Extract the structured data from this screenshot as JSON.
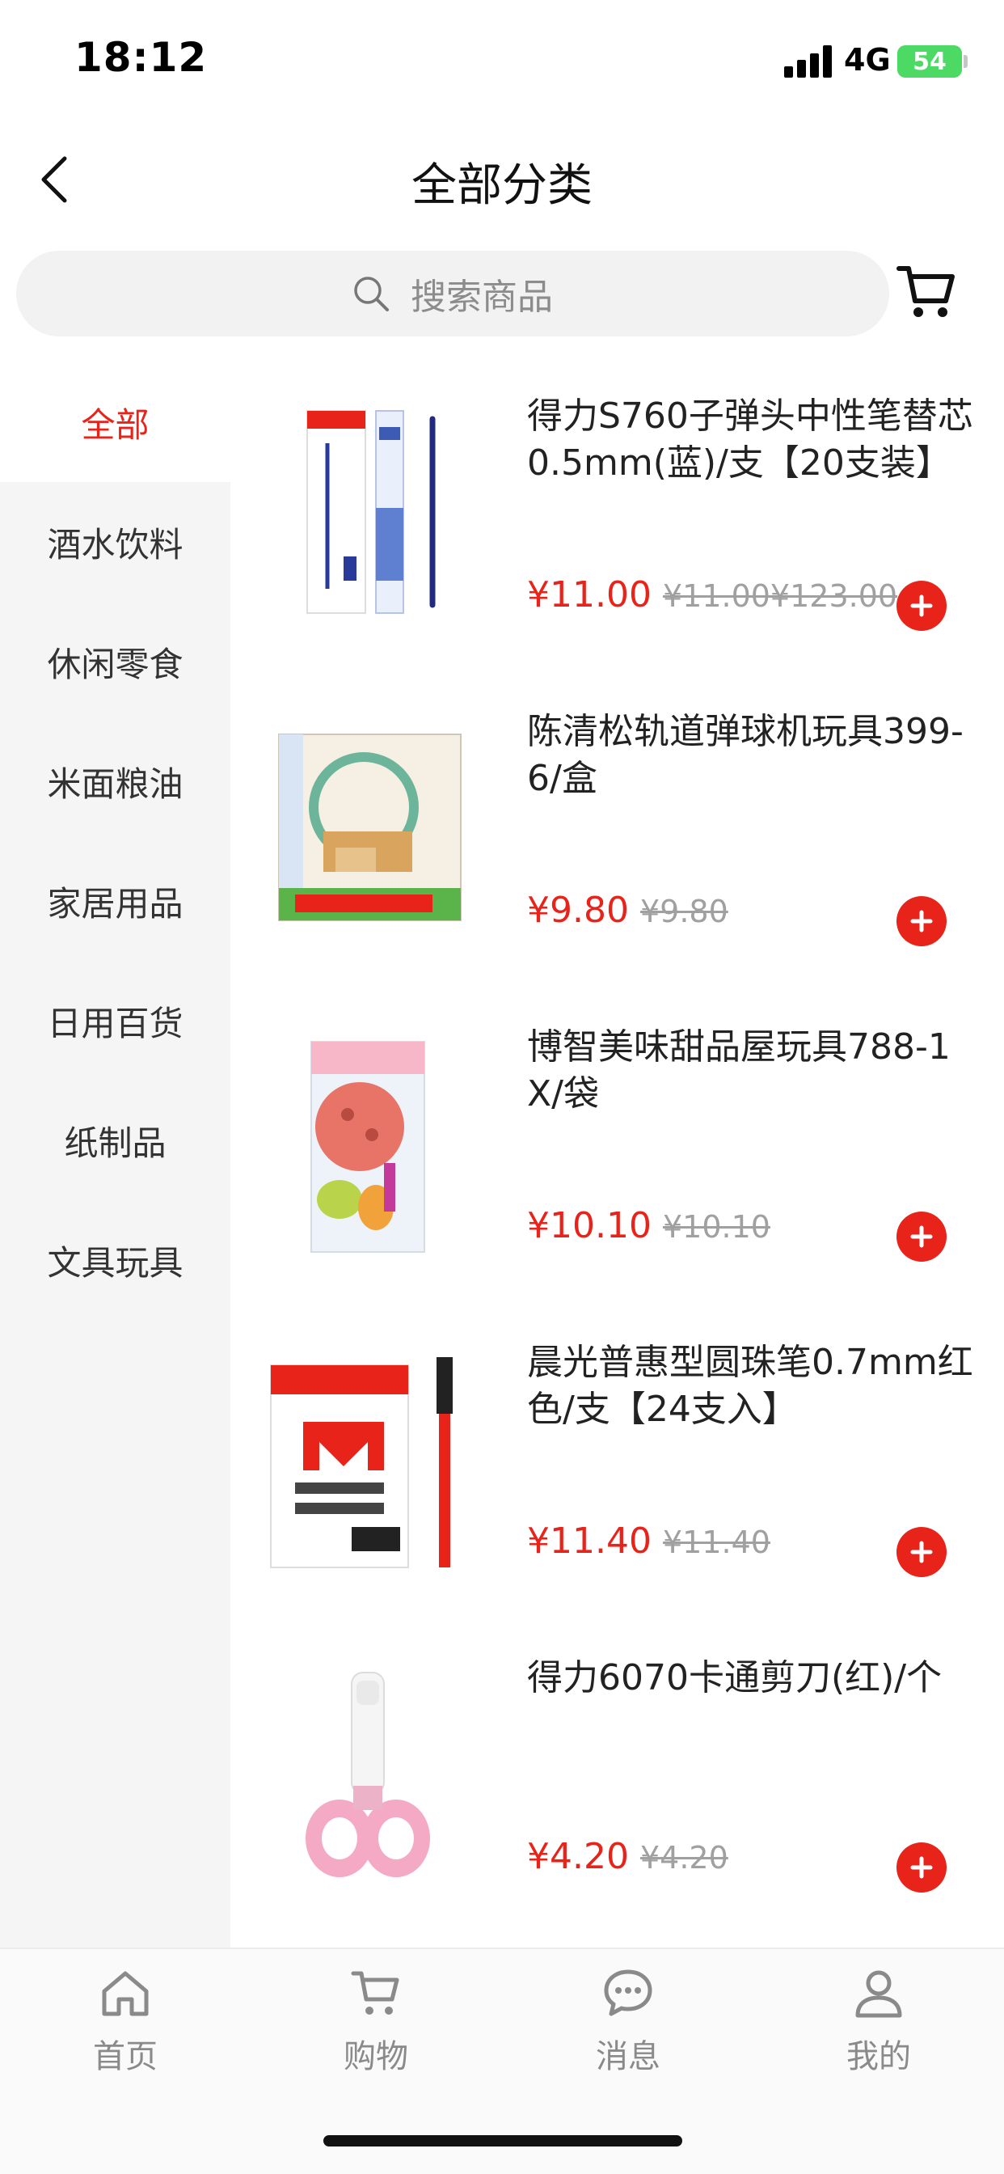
{
  "status_bar": {
    "time": "18:12",
    "network": "4G",
    "battery": "54"
  },
  "nav": {
    "title": "全部分类"
  },
  "search": {
    "placeholder": "搜索商品"
  },
  "sidebar": {
    "items": [
      {
        "label": "全部",
        "active": true
      },
      {
        "label": "酒水饮料"
      },
      {
        "label": "休闲零食"
      },
      {
        "label": "米面粮油"
      },
      {
        "label": "家居用品"
      },
      {
        "label": "日用百货"
      },
      {
        "label": "纸制品"
      },
      {
        "label": "文具玩具"
      }
    ]
  },
  "products": [
    {
      "name": "得力S760子弹头中性笔替芯0.5mm(蓝)/支【20支装】",
      "price": "¥11.00",
      "original_price": "¥11.00¥123.00",
      "image_icon": "pen-refill-image"
    },
    {
      "name": "陈清松轨道弹球机玩具399-6/盒",
      "price": "¥9.80",
      "original_price": "¥9.80",
      "image_icon": "pinball-toy-image"
    },
    {
      "name": "博智美味甜品屋玩具788-1X/袋",
      "price": "¥10.10",
      "original_price": "¥10.10",
      "image_icon": "pizza-toy-image"
    },
    {
      "name": "晨光普惠型圆珠笔0.7mm红色/支【24支入】",
      "price": "¥11.40",
      "original_price": "¥11.40",
      "image_icon": "ballpoint-pen-image"
    },
    {
      "name": "得力6070卡通剪刀(红)/个",
      "price": "¥4.20",
      "original_price": "¥4.20",
      "image_icon": "scissors-image"
    }
  ],
  "tab_bar": {
    "items": [
      {
        "label": "首页",
        "icon": "home-icon"
      },
      {
        "label": "购物",
        "icon": "cart-icon"
      },
      {
        "label": "消息",
        "icon": "message-icon"
      },
      {
        "label": "我的",
        "icon": "profile-icon"
      }
    ]
  },
  "colors": {
    "accent": "#e8231a",
    "battery": "#4cd964",
    "sidebar_bg": "#f5f5f5"
  }
}
